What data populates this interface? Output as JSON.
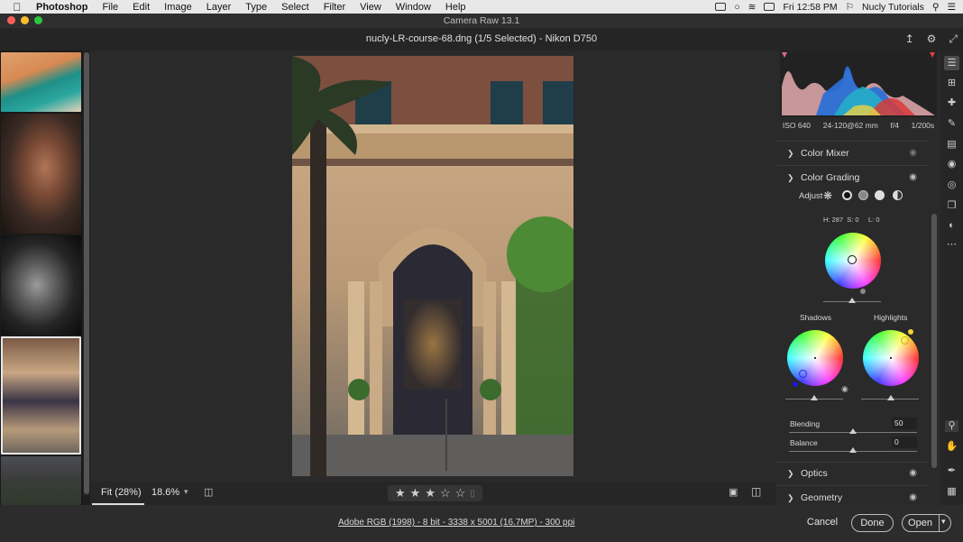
{
  "menubar": {
    "app": "Photoshop",
    "items": [
      "File",
      "Edit",
      "Image",
      "Layer",
      "Type",
      "Select",
      "Filter",
      "View",
      "Window",
      "Help"
    ],
    "clock": "Fri 12:58 PM",
    "user": "Nucly Tutorials"
  },
  "window": {
    "title": "Camera Raw 13.1"
  },
  "header": {
    "filename": "nucly-LR-course-68.dng (1/5 Selected)  -  Nikon D750"
  },
  "exif": {
    "iso": "ISO 640",
    "lens": "24-120@62 mm",
    "aperture": "f/4",
    "shutter": "1/200s"
  },
  "sections": {
    "color_mixer": "Color Mixer",
    "color_grading": "Color Grading",
    "optics": "Optics",
    "geometry": "Geometry"
  },
  "grading": {
    "adjust_label": "Adjust",
    "readout": "H: 287  S: 0     L: 0",
    "shadows_label": "Shadows",
    "highlights_label": "Highlights",
    "blending_label": "Blending",
    "blending_value": "50",
    "balance_label": "Balance",
    "balance_value": "0"
  },
  "canvas_bar": {
    "fit": "Fit (28%)",
    "zoom": "18.6%",
    "rating": 3,
    "rating_max": 5
  },
  "footer": {
    "image_info": "Adobe RGB (1998) - 8 bit - 3338 x 5001 (16.7MP) - 300 ppi",
    "cancel": "Cancel",
    "done": "Done",
    "open": "Open"
  },
  "colors": {
    "accent_blue": "#2b6fd6",
    "panel_bg": "#2a2a2a"
  }
}
